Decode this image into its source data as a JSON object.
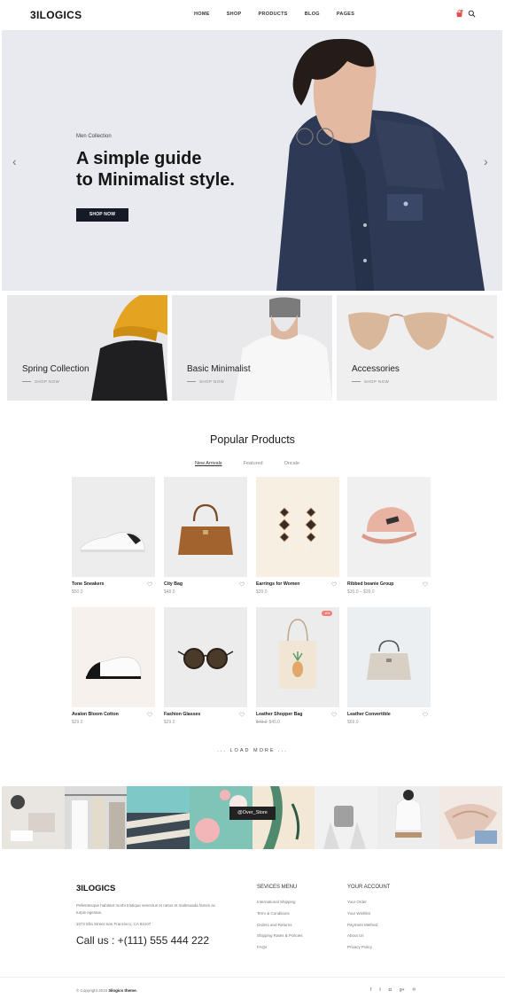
{
  "header": {
    "logo": "3ILOGICS",
    "nav": [
      "HOME",
      "SHOP",
      "PRODUCTS",
      "BLOG",
      "PAGES"
    ],
    "cart_count": "0"
  },
  "hero": {
    "subtitle": "Men Collection",
    "title_line1": "A simple guide",
    "title_line2": "to Minimalist style.",
    "button": "SHOP NOW"
  },
  "categories": [
    {
      "name": "Spring Collection",
      "link": "SHOP NOW"
    },
    {
      "name": "Basic Minimalist",
      "link": "SHOP NOW"
    },
    {
      "name": "Accessories",
      "link": "SHOP NOW"
    }
  ],
  "popular": {
    "title": "Popular Products",
    "tabs": [
      "New Arrivals",
      "Featured",
      "Oncale"
    ],
    "load_more": "... LOAD MORE ..."
  },
  "products": [
    {
      "name": "Tone Sneakers",
      "price": "$50.0",
      "old_price": ""
    },
    {
      "name": "City Bag",
      "price": "$48.0",
      "old_price": ""
    },
    {
      "name": "Earrings for Women",
      "price": "$39.0",
      "old_price": ""
    },
    {
      "name": "Ribbed beanie Group",
      "price": "$30.0 – $39.0",
      "old_price": ""
    },
    {
      "name": "Avalon Bloom Cotton",
      "price": "$29.0",
      "old_price": ""
    },
    {
      "name": "Fashion Glasses",
      "price": "$29.0",
      "old_price": ""
    },
    {
      "name": "Leather Shopper Bag",
      "price": "$45.0",
      "old_price": "$49.0",
      "badge": "-8%"
    },
    {
      "name": "Leather Convertible",
      "price": "$69.0",
      "old_price": ""
    }
  ],
  "instagram": {
    "tag": "@Over_Store"
  },
  "footer": {
    "logo": "3ILOGICS",
    "text": "Pellentesque habitant morbi tristique senectus et netus et malesuada fames ac turpis egestas.",
    "address": "1072 Ella Street San Francisco, CA 94107",
    "call": "Call us : +(111) 555 444 222",
    "services_title": "SEVICES MENU",
    "services": [
      "International Shipping",
      "Term & Conditions",
      "Orders and Returns",
      "Shipping Rates & Policies",
      "FAQs"
    ],
    "account_title": "YOUR ACCOUNT",
    "account": [
      "Your Order",
      "Your Wishlist",
      "Payment Method",
      "About Us",
      "Privacy Policy"
    ],
    "copyright": "© Copyright 2016",
    "brand": "3ilogics theme."
  },
  "social_icons": [
    "facebook-icon",
    "twitter-icon",
    "instagram-icon",
    "google-plus-icon",
    "pinterest-icon"
  ],
  "colors": {
    "hero_bg": "#e8eaef",
    "button": "#151a26",
    "badge": "#f37b74"
  }
}
